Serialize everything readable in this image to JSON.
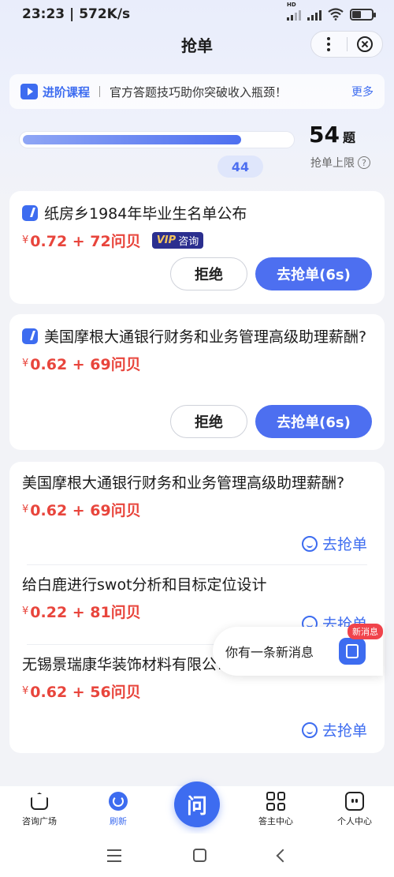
{
  "status_bar": {
    "time": "23:23",
    "speed": "572K/s",
    "network_badge": "HD"
  },
  "header": {
    "title": "抢单",
    "more_icon": "more-vertical-icon",
    "close_icon": "close-circle-icon"
  },
  "promo": {
    "title": "进阶课程",
    "text": "官方答题技巧助你突破收入瓶颈！",
    "more": "更多"
  },
  "progress": {
    "current": "44",
    "current_value": 44,
    "limit": "54",
    "limit_unit": "题",
    "limit_label": "抢单上限",
    "help": "?"
  },
  "cards": [
    {
      "question": "纸房乡1984年毕业生名单公布",
      "currency": "¥",
      "price": "0.72 + 72问贝",
      "vip_v": "VIP",
      "vip_label": "咨询",
      "reject": "拒绝",
      "grab": "去抢单(6s)"
    },
    {
      "question": "美国摩根大通银行财务和业务管理高级助理薪酬?",
      "currency": "¥",
      "price": "0.62 + 69问贝",
      "reject": "拒绝",
      "grab": "去抢单(6s)"
    }
  ],
  "list": [
    {
      "question": "美国摩根大通银行财务和业务管理高级助理薪酬?",
      "currency": "¥",
      "price": "0.62 + 69问贝",
      "grab": "去抢单"
    },
    {
      "question": "给白鹿进行swot分析和目标定位设计",
      "currency": "¥",
      "price": "0.22 + 81问贝",
      "grab": "去抢单"
    },
    {
      "question": "无锡景瑞康华装饰材料有限公司地址",
      "currency": "¥",
      "price": "0.62 + 56问贝",
      "grab": "去抢单"
    }
  ],
  "toast": {
    "text": "你有一条新消息",
    "badge": "新消息"
  },
  "tabbar": {
    "items": [
      {
        "label": "咨询广场",
        "icon": "home-icon"
      },
      {
        "label": "刷新",
        "icon": "refresh-icon"
      },
      {
        "label": "答主中心",
        "icon": "grid-icon"
      },
      {
        "label": "个人中心",
        "icon": "person-icon"
      }
    ],
    "center": "问"
  },
  "colors": {
    "accent": "#3d6cf0",
    "price": "#e8453c",
    "badge": "#f0434b"
  }
}
